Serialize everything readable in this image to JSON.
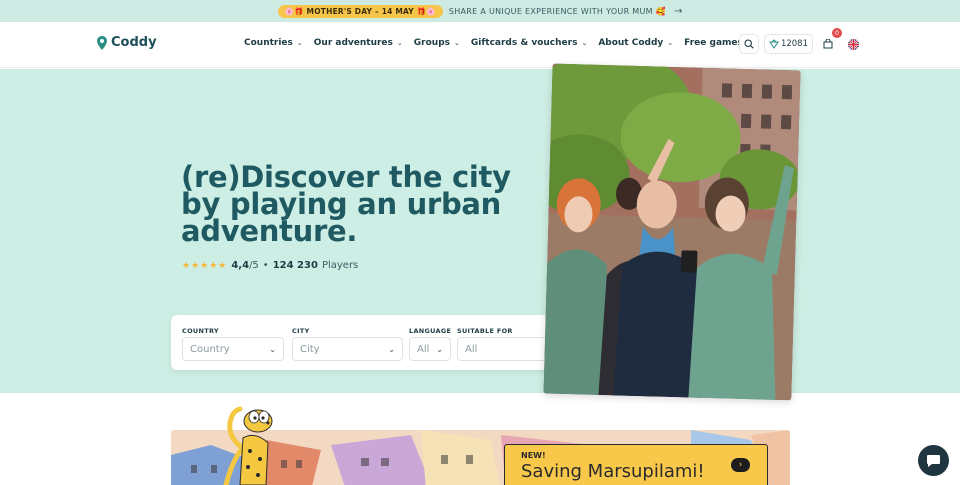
{
  "announcement": {
    "pill": "🌸🎁 MOTHER'S DAY – 14 MAY 🎁🌸",
    "text": "SHARE A UNIQUE EXPERIENCE WITH YOUR MUM 🥰",
    "arrow": "→"
  },
  "header": {
    "brand": "Coddy",
    "nav": [
      {
        "label": "Countries",
        "has_dropdown": true
      },
      {
        "label": "Our adventures",
        "has_dropdown": true
      },
      {
        "label": "Groups",
        "has_dropdown": true
      },
      {
        "label": "Giftcards & vouchers",
        "has_dropdown": true
      },
      {
        "label": "About Coddy",
        "has_dropdown": true
      },
      {
        "label": "Free games",
        "has_dropdown": false
      }
    ],
    "points": "12081",
    "cart_count": "0",
    "language": "en-GB"
  },
  "hero": {
    "title": "(re)Discover the city by playing an urban adventure.",
    "rating_stars": "★★★★★",
    "rating_value": "4,4",
    "rating_scale": "/5",
    "separator": "•",
    "players_count": "124 230",
    "players_label": "Players"
  },
  "search": {
    "country": {
      "label": "COUNTRY",
      "value": "Country"
    },
    "city": {
      "label": "CITY",
      "value": "City"
    },
    "language": {
      "label": "LANGUAGE",
      "value": "All"
    },
    "suitable_for": {
      "label": "SUITABLE FOR",
      "value": "All"
    }
  },
  "promo_banner": {
    "badge": "NEW!",
    "title": "Saving Marsupilami!",
    "arrow": "›"
  },
  "colors": {
    "hero_bg": "#cdeee4",
    "brand_dark": "#1f5962",
    "accent_teal": "#2c8f85",
    "promo_yellow": "#f6c64a",
    "star": "#f4b63a"
  }
}
